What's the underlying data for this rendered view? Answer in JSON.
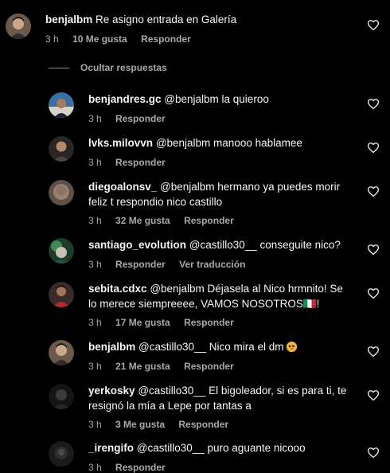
{
  "comments": {
    "top": {
      "username": "benjalbm",
      "text": "Re asigno entrada en Galería",
      "time": "3 h",
      "likes": "10 Me gusta",
      "reply_label": "Responder"
    },
    "hide_replies_label": "Ocultar respuestas",
    "replies": [
      {
        "username": "benjandres.gc",
        "text": "@benjalbm la quieroo",
        "time": "3 h",
        "reply_label": "Responder"
      },
      {
        "username": "lvks.milovvn",
        "text": "@benjalbm manooo hablamee",
        "time": "3 h",
        "reply_label": "Responder"
      },
      {
        "username": "diegoalonsv_",
        "text": "@benjalbm hermano ya puedes morir feliz t respondio nico castillo",
        "time": "3 h",
        "likes": "32 Me gusta",
        "reply_label": "Responder"
      },
      {
        "username": "santiago_evolution",
        "text": "@castillo30__ conseguite nico?",
        "time": "3 h",
        "reply_label": "Responder",
        "translate_label": "Ver traducción"
      },
      {
        "username": "sebita.cdxc",
        "text": "@benjalbm Déjasela al Nico hrmnito! Se lo merece siempreeee, VAMOS NOSOTROS",
        "suffix": "🇮🇹!",
        "time": "3 h",
        "likes": "17 Me gusta",
        "reply_label": "Responder"
      },
      {
        "username": "benjalbm",
        "text": "@castillo30__ Nico mira el dm",
        "emoji": "pleading-face-emoji",
        "time": "3 h",
        "likes": "21 Me gusta",
        "reply_label": "Responder"
      },
      {
        "username": "yerkosky",
        "text": "@castillo30__ El bigoleador, si es para ti, te resignó la mía a Lepe por tantas a",
        "time": "3 h",
        "likes": "3 Me gusta",
        "reply_label": "Responder"
      },
      {
        "username": "_irengifo",
        "text": "@castillo30__ puro aguante nicooo",
        "time": "3 h",
        "reply_label": "Responder"
      }
    ]
  },
  "icons": {
    "like": "heart-outline-icon"
  },
  "colors": {
    "background": "#000000",
    "text": "#f5f5f5",
    "secondary": "#a8a8a8"
  }
}
